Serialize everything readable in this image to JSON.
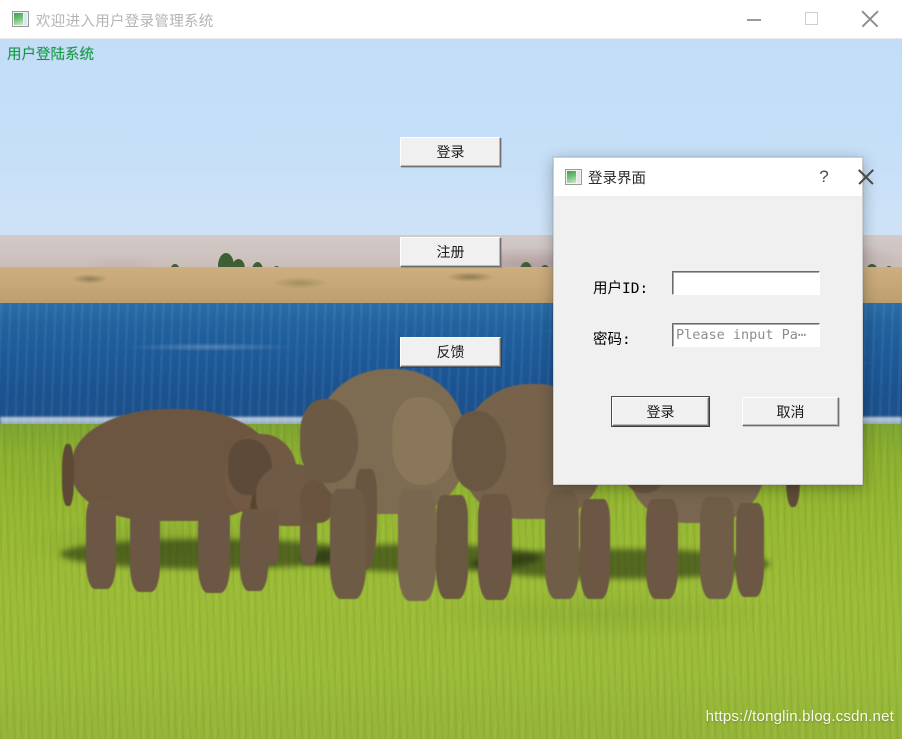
{
  "window": {
    "title": "欢迎进入用户登录管理系统",
    "icon": "qt-app-icon",
    "controls": {
      "minimize": "minimize-icon",
      "maximize": "maximize-icon",
      "close": "close-icon"
    }
  },
  "main": {
    "heading": "用户登陆系统",
    "heading_color": "#0f9c3f",
    "buttons": {
      "login": "登录",
      "register": "注册",
      "feedback": "反馈"
    }
  },
  "dialog": {
    "title": "登录界面",
    "icon": "qt-app-icon",
    "help_label": "?",
    "close_label": "close-icon",
    "fields": {
      "userid_label": "用户ID:",
      "userid_value": "",
      "userid_placeholder": "",
      "password_label": "密码:",
      "password_value": "",
      "password_placeholder": "Please input Pa⋯"
    },
    "buttons": {
      "ok": "登录",
      "cancel": "取消"
    }
  },
  "watermark": "https://tonglin.blog.csdn.net",
  "background": {
    "description": "photo-elephant-herd-lakeside",
    "sky_color": "#c7e0f8",
    "water_color": "#1d5998",
    "grass_color": "#9dbd38",
    "elephant_color": "#6b5743"
  }
}
